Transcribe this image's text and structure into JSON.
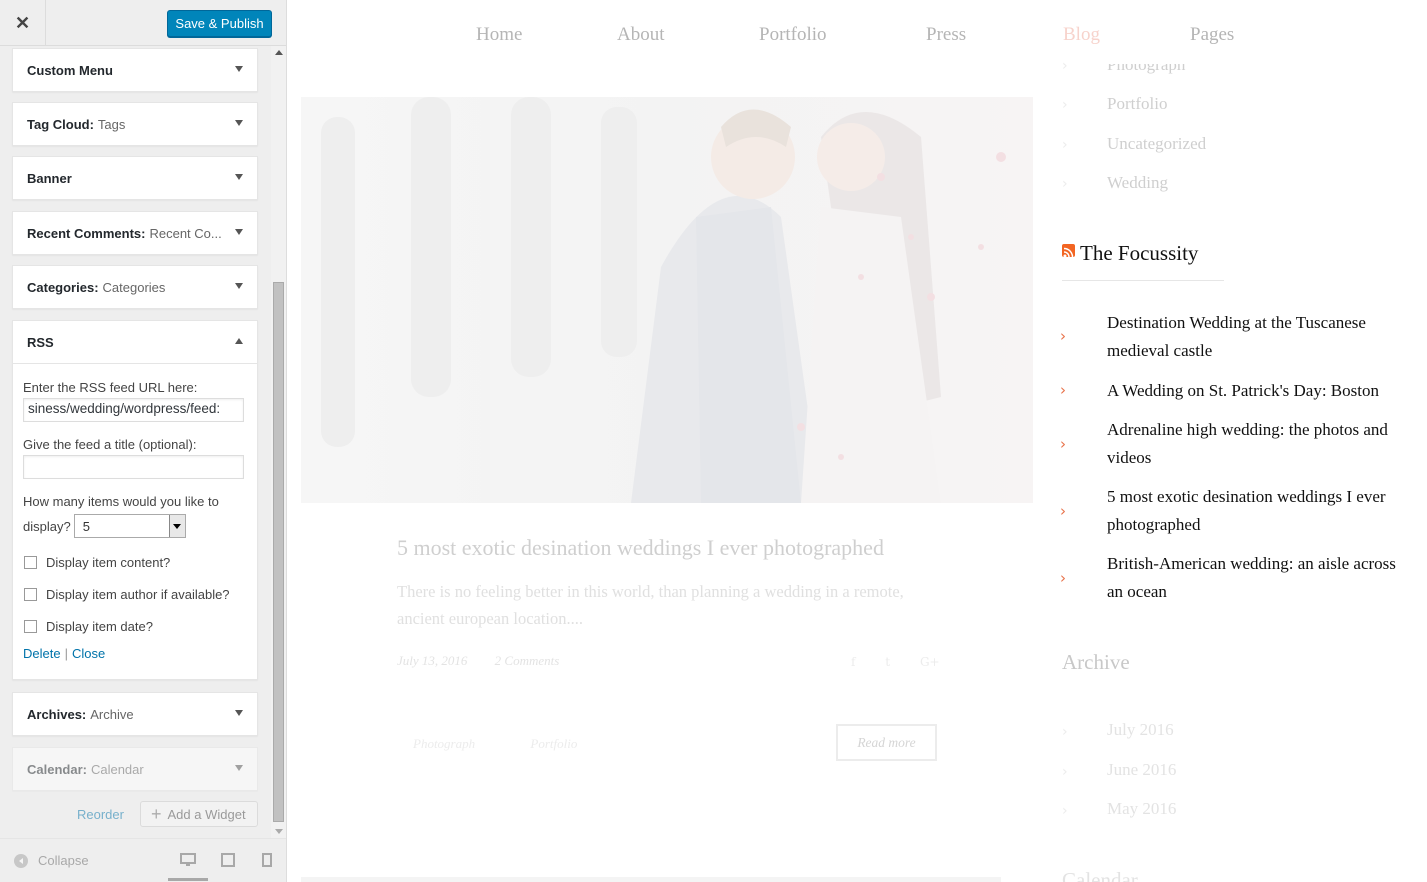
{
  "customizer": {
    "close_icon": "close-icon",
    "save_label": "Save & Publish",
    "widgets": [
      {
        "title": "Custom Menu",
        "subtitle": ""
      },
      {
        "title": "Tag Cloud:",
        "subtitle": "Tags"
      },
      {
        "title": "Banner",
        "subtitle": ""
      },
      {
        "title": "Recent Comments:",
        "subtitle": "Recent Co..."
      },
      {
        "title": "Categories:",
        "subtitle": "Categories"
      },
      {
        "title": "RSS",
        "subtitle": ""
      },
      {
        "title": "Archives:",
        "subtitle": "Archive"
      },
      {
        "title": "Calendar:",
        "subtitle": "Calendar"
      }
    ],
    "rss_form": {
      "url_label": "Enter the RSS feed URL here:",
      "url_value": "/business/wedding/wordpress/feed",
      "url_value_visible": ":siness/wedding/wordpress/feed",
      "title_label": "Give the feed a title (optional):",
      "title_value": "",
      "items_label_line1": "How many items would you like to",
      "items_label_line2": "display?",
      "items_value": "5",
      "check_content": "Display item content?",
      "check_author": "Display item author if available?",
      "check_date": "Display item date?",
      "delete_link": "Delete",
      "separator": "|",
      "close_link": "Close"
    },
    "reorder_label": "Reorder",
    "add_widget_label": "Add a Widget",
    "collapse_label": "Collapse",
    "colors": {
      "primary": "#0085ba",
      "link": "#0073aa",
      "panel": "#eeeeee"
    }
  },
  "preview": {
    "nav": [
      "Home",
      "About",
      "Portfolio",
      "Press",
      "Blog",
      "Pages"
    ],
    "active_nav": "Blog",
    "active_color": "#f4c7c0",
    "post": {
      "title": "5 most exotic desination weddings I ever photographed",
      "excerpt": "There is no feeling better in this world, than planning a wedding in a remote, ancient european location....",
      "date": "July 13, 2016",
      "comments": "2 Comments",
      "social": [
        "f",
        "t",
        "G+"
      ],
      "tags": [
        "Photograph",
        "Portfolio"
      ],
      "read_more": "Read more"
    },
    "categories": [
      "Photograph",
      "Portfolio",
      "Uncategorized",
      "Wedding"
    ],
    "rss_widget": {
      "title": "The Focussity",
      "items": [
        "Destination Wedding at the Tuscanese medieval castle",
        "A Wedding on St. Patrick's Day: Boston",
        "Adrenaline high wedding: the photos and videos",
        "5 most exotic desination weddings I ever photographed",
        "British-American wedding: an aisle across an ocean"
      ]
    },
    "archive": {
      "title": "Archive",
      "items": [
        "July 2016",
        "June 2016",
        "May 2016"
      ]
    },
    "calendar_title": "Calendar"
  }
}
